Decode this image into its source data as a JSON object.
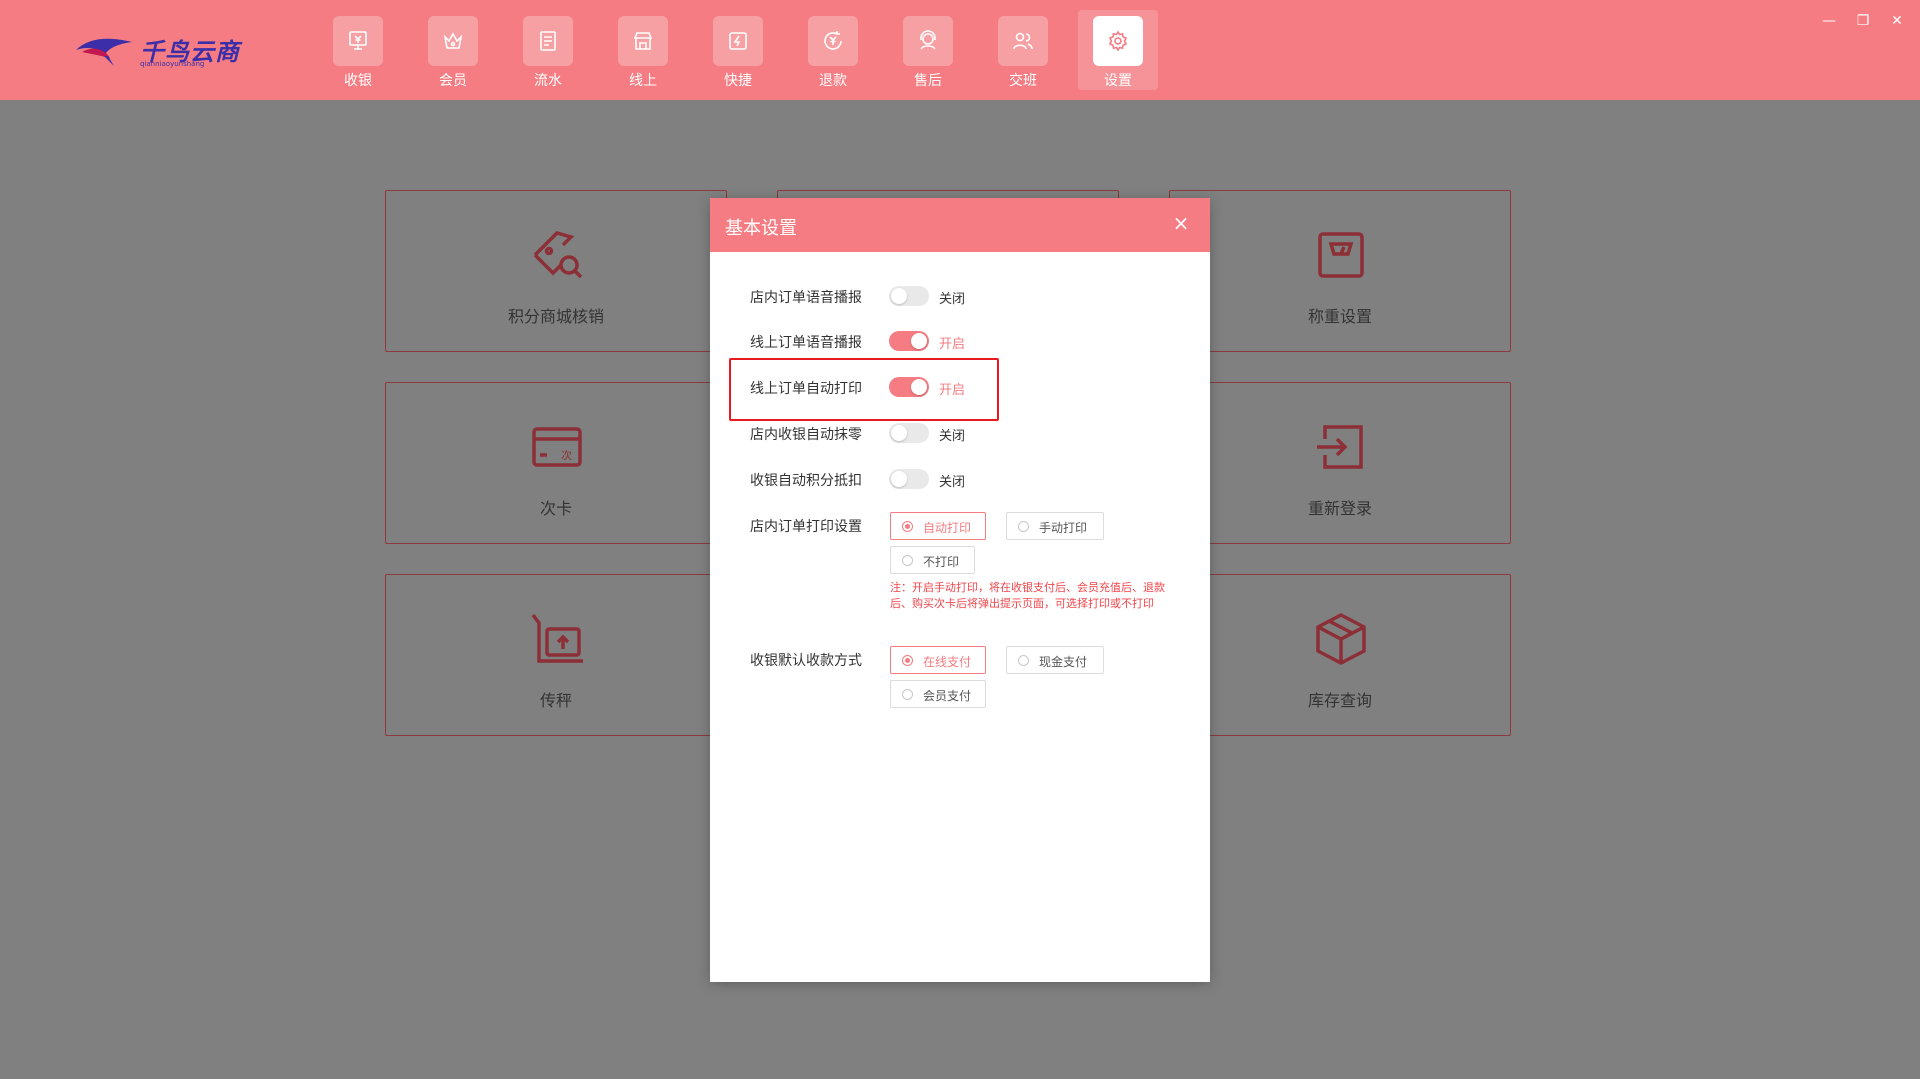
{
  "app": {
    "logo_text": "千鸟云商",
    "logo_subtext": "qianniaoyunshang"
  },
  "nav": {
    "items": [
      {
        "label": "收银",
        "icon": "cashier-icon"
      },
      {
        "label": "会员",
        "icon": "member-icon"
      },
      {
        "label": "流水",
        "icon": "ledger-icon"
      },
      {
        "label": "线上",
        "icon": "online-store-icon"
      },
      {
        "label": "快捷",
        "icon": "shortcut-icon"
      },
      {
        "label": "退款",
        "icon": "refund-icon"
      },
      {
        "label": "售后",
        "icon": "aftersale-icon"
      },
      {
        "label": "交班",
        "icon": "handover-icon"
      },
      {
        "label": "设置",
        "icon": "gear-icon",
        "active": true
      }
    ]
  },
  "window_controls": {
    "minimize": "—",
    "restore": "❐",
    "close": "✕"
  },
  "grid": {
    "items": [
      {
        "label": "积分商城核销",
        "icon": "coupon-check-icon"
      },
      {
        "label": "称重设置",
        "icon": "scale-icon"
      },
      {
        "label": "次卡",
        "icon": "card-icon"
      },
      {
        "label": "重新登录",
        "icon": "login-icon"
      },
      {
        "label": "传秤",
        "icon": "upload-scale-icon"
      },
      {
        "label": "库存查询",
        "icon": "box-icon"
      }
    ]
  },
  "modal": {
    "title": "基本设置",
    "close": "×",
    "toggles": [
      {
        "label": "店内订单语音播报",
        "on": false,
        "state_text": "关闭"
      },
      {
        "label": "线上订单语音播报",
        "on": true,
        "state_text": "开启"
      },
      {
        "label": "线上订单自动打印",
        "on": true,
        "state_text": "开启"
      },
      {
        "label": "店内收银自动抹零",
        "on": false,
        "state_text": "关闭"
      },
      {
        "label": "收银自动积分抵扣",
        "on": false,
        "state_text": "关闭"
      }
    ],
    "print_setting": {
      "label": "店内订单打印设置",
      "options": [
        "自动打印",
        "手动打印",
        "不打印"
      ],
      "selected": "自动打印",
      "note": "注：开启手动打印，将在收银支付后、会员充值后、退款后、购买次卡后将弹出提示页面，可选择打印或不打印"
    },
    "payment_setting": {
      "label": "收银默认收款方式",
      "options": [
        "在线支付",
        "现金支付",
        "会员支付"
      ],
      "selected": "在线支付"
    }
  },
  "colors": {
    "accent": "#f47c82",
    "overlay": "#808080",
    "warning_text": "#f0454b",
    "highlight_box": "#e8191f",
    "logo": "#3b2ea8"
  }
}
